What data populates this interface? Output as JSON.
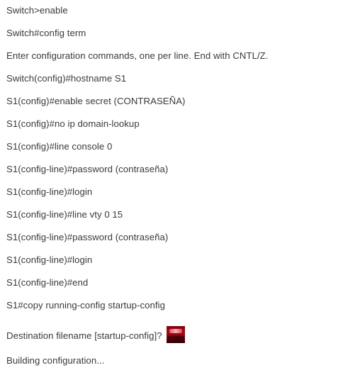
{
  "lines": [
    "Switch>enable",
    "Switch#config term",
    "Enter configuration commands, one per line. End with CNTL/Z.",
    "Switch(config)#hostname S1",
    "S1(config)#enable secret (CONTRASEÑA)",
    "S1(config)#no ip domain-lookup",
    "S1(config)#line console 0",
    "S1(config-line)#password (contraseña)",
    "S1(config-line)#login",
    "S1(config-line)#line vty 0 15",
    "S1(config-line)#password (contraseña)",
    "S1(config-line)#login",
    "S1(config-line)#end",
    "S1#copy running-config startup-config",
    "Destination filename [startup-config]?",
    "Building configuration..."
  ],
  "inline_image": {
    "icon": "red-cursor-image-icon",
    "accent_color": "#a50a18"
  },
  "colors": {
    "text": "#3a3a3a",
    "background": "#ffffff"
  }
}
